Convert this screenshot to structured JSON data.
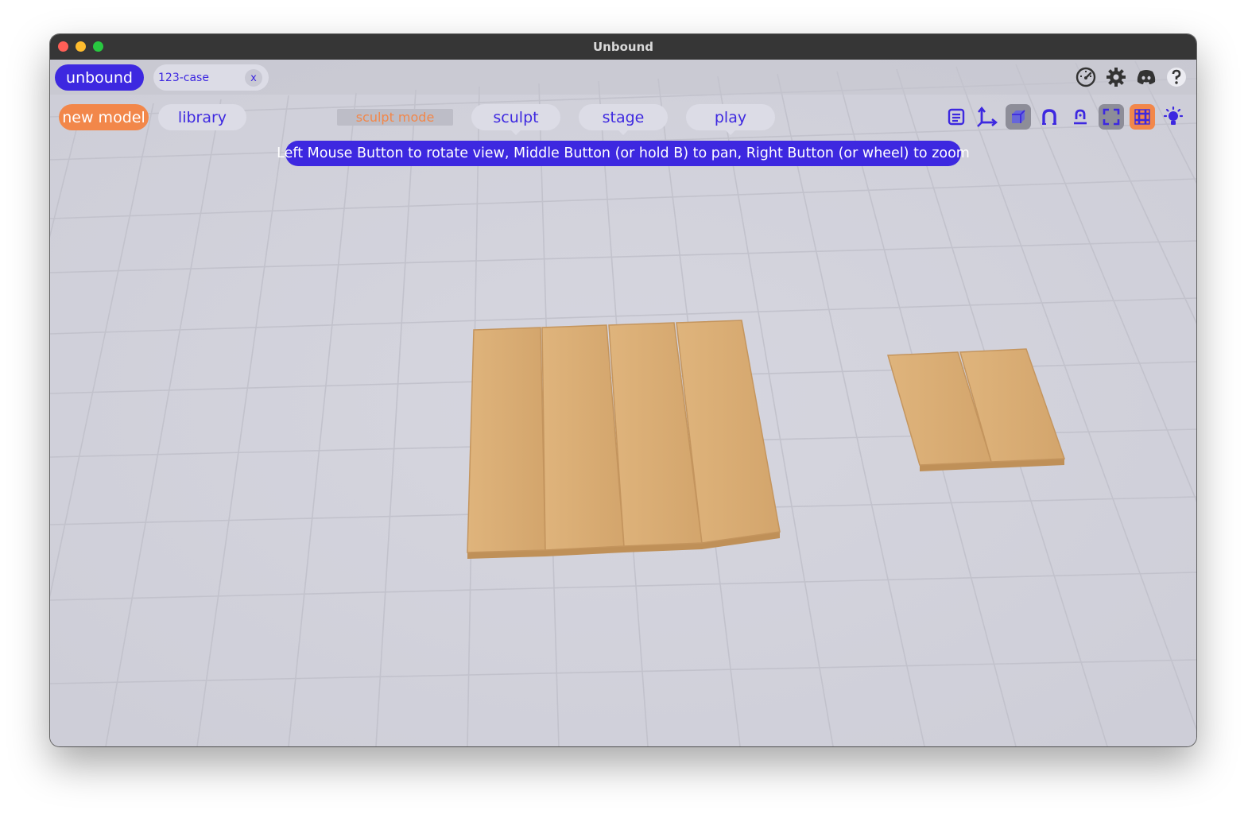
{
  "window": {
    "title": "Unbound"
  },
  "topbar": {
    "brand_label": "unbound",
    "tab": {
      "label": "123-case",
      "close_label": "x"
    },
    "icons": [
      "speed-gauge-icon",
      "gear-icon",
      "discord-icon",
      "help-icon"
    ]
  },
  "toolbar": {
    "new_model_label": "new model",
    "library_label": "library",
    "mode_label": "sculpt mode",
    "modes": [
      "sculpt",
      "stage",
      "play"
    ],
    "tools": [
      "list-icon",
      "axes-icon",
      "cube-view-icon",
      "magnet-icon",
      "anchor-icon",
      "fullscreen-icon",
      "grid-icon",
      "light-icon"
    ],
    "active_tools": [
      "cube-view-icon",
      "fullscreen-icon",
      "grid-icon"
    ]
  },
  "hint": {
    "text": "Left Mouse Button to rotate view, Middle Button (or hold B) to pan, Right Button (or wheel) to zoom"
  },
  "scene": {
    "objects": [
      {
        "name": "plank-group-large",
        "pieces": 4
      },
      {
        "name": "plank-group-small",
        "pieces": 2
      }
    ]
  },
  "colors": {
    "accent": "#3d28e0",
    "orange": "#f2874a",
    "plank": "#d8ab72",
    "viewport_bg": "#d3d3dc",
    "grid_line": "#c2c2cc"
  }
}
